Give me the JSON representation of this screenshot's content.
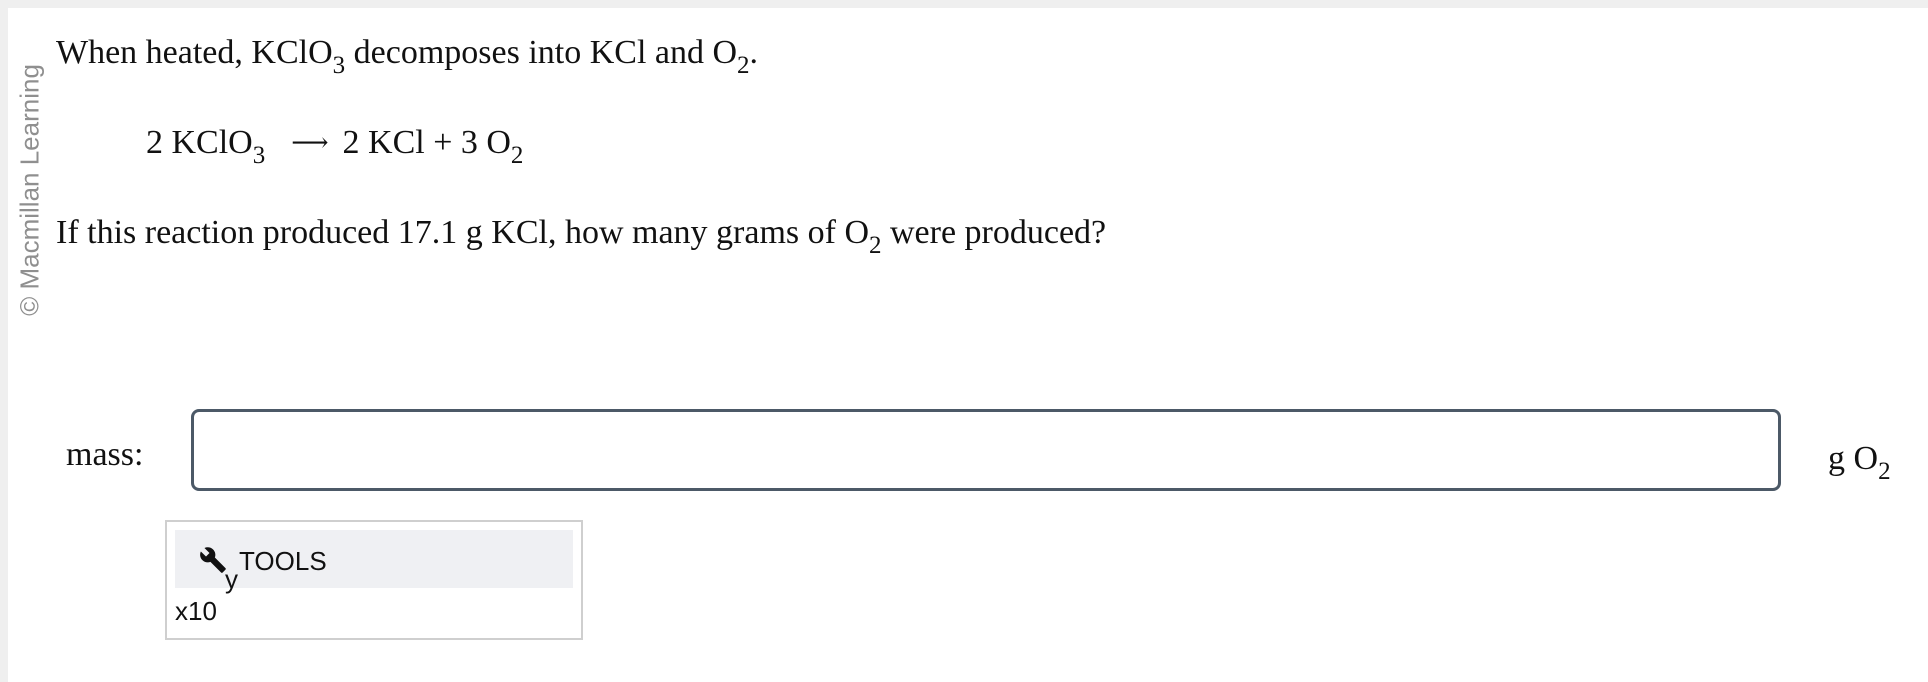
{
  "sidebar": {
    "copyright": "© Macmillan Learning"
  },
  "question": {
    "intro": {
      "text1": "When heated, KClO",
      "sub1": "3",
      "text2": " decomposes into KCl and O",
      "sub2": "2",
      "text3": "."
    },
    "equation": {
      "reactant": "2 KClO",
      "reactant_sub": "3",
      "arrow": "⟶",
      "products": "2 KCl + 3 O",
      "products_sub": "2"
    },
    "prompt": {
      "text1": "If this reaction produced 17.1 g KCl, how many grams of O",
      "sub1": "2",
      "text2": " were produced?"
    }
  },
  "answer": {
    "label": "mass:",
    "value": "",
    "placeholder": "",
    "unit": "g O",
    "unit_sub": "2"
  },
  "tools": {
    "icon": "wrench-icon",
    "icon_sub": "y",
    "label": "TOOLS",
    "sci_notation": "x10"
  }
}
